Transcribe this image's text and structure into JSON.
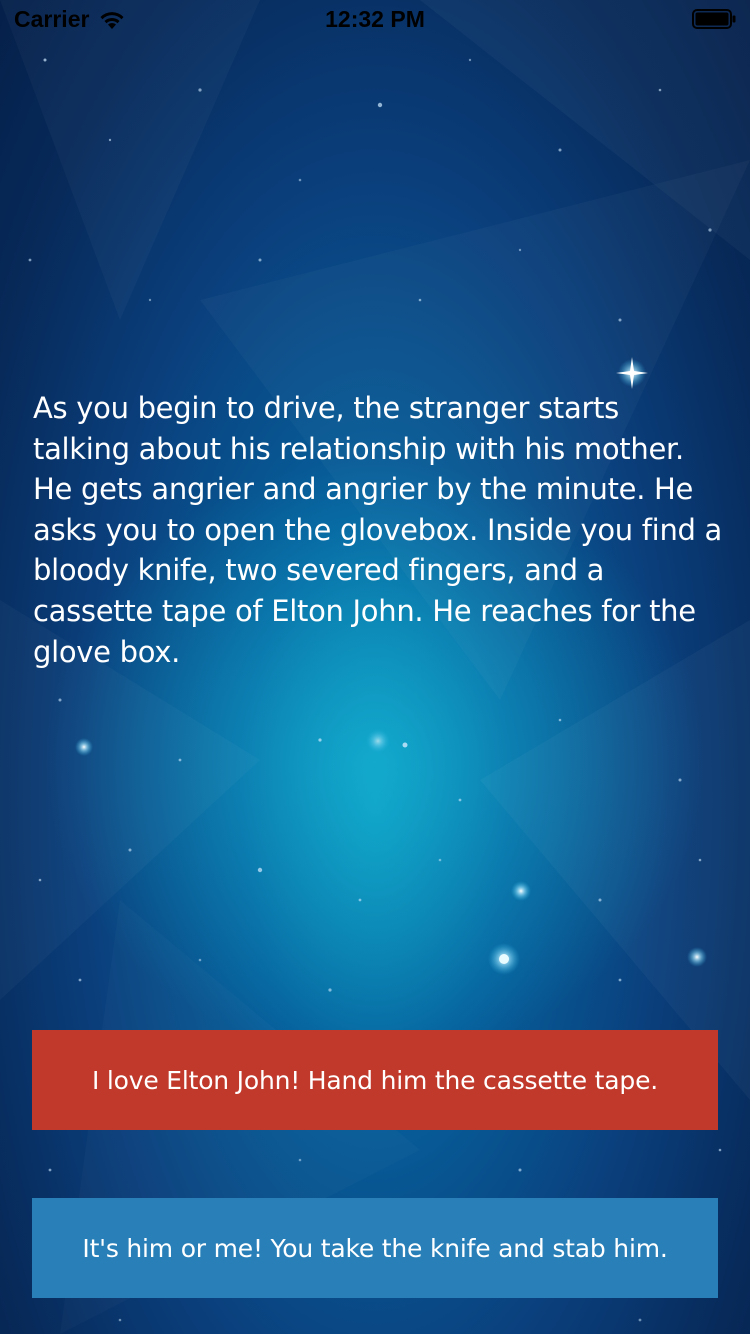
{
  "status_bar": {
    "carrier": "Carrier",
    "time": "12:32 PM",
    "wifi_icon": "wifi-icon",
    "battery_icon": "battery-icon"
  },
  "story": {
    "text": "As you begin to drive, the stranger starts talking about his relationship with his mother. He gets angrier and angrier by the minute. He asks you to open the glovebox. Inside you find a bloody knife, two severed fingers, and a cassette tape of Elton John. He reaches for the glove box."
  },
  "choices": [
    {
      "label": "I love Elton John! Hand him the cassette tape.",
      "color": "#c0392b"
    },
    {
      "label": "It's him or me! You take the knife and stab him.",
      "color": "#2980b9"
    }
  ],
  "colors": {
    "background_center": "#0a8fb8",
    "background_edge": "#05204a",
    "text": "#ffffff"
  }
}
